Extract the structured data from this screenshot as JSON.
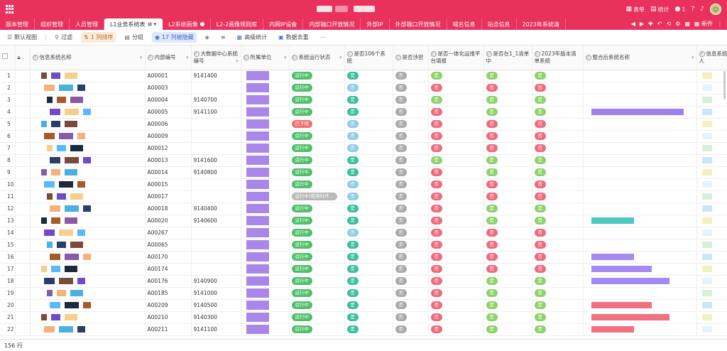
{
  "topbar": {
    "actions": [
      {
        "icon": "sheet-icon",
        "label": "表单"
      },
      {
        "icon": "stats-icon",
        "label": "统计"
      },
      {
        "icon": "user-icon",
        "label": "1"
      },
      {
        "icon": "help-icon",
        "label": ""
      },
      {
        "icon": "bell-icon",
        "label": ""
      }
    ],
    "brand_color": "#e8315c"
  },
  "tabs": [
    {
      "label": "版本管理"
    },
    {
      "label": "组织管理"
    },
    {
      "label": "人员管理"
    },
    {
      "label": "L1业务系统表",
      "active": true
    },
    {
      "label": "L2系统画像"
    },
    {
      "label": "L2-2画像规则库"
    },
    {
      "label": "内网IP设备"
    },
    {
      "label": "内部端口开放情况"
    },
    {
      "label": "外部IP"
    },
    {
      "label": "外部端口开放情况"
    },
    {
      "label": "域名信息"
    },
    {
      "label": "站点信息"
    },
    {
      "label": "2023年系统清"
    }
  ],
  "tab_tools": {
    "new_label": "新件"
  },
  "toolbar": {
    "default_view": "默认视图",
    "filter": "过滤",
    "sort": "1 列排序",
    "group": "分组",
    "hidden": "17 列被隐藏",
    "advanced_stats": "高级统计",
    "dedupe": "数据去重"
  },
  "columns": [
    {
      "label": "信息系统名称"
    },
    {
      "label": "内部编号"
    },
    {
      "label": "大数据中心系统编号"
    },
    {
      "label": "所属单位"
    },
    {
      "label": "系统运行状态"
    },
    {
      "label": "是否106个系统"
    },
    {
      "label": "是否涉密"
    },
    {
      "label": "是否一体化运维平台填报"
    },
    {
      "label": "是否在1_1清单中"
    },
    {
      "label": "2023年版本清单系统"
    },
    {
      "label": "整合后系统名称"
    },
    {
      "label": "信息系统联系人"
    }
  ],
  "rows": [
    {
      "n": "1",
      "id": "A00001",
      "bd": "9141400",
      "st": "运行中",
      "s106": "是",
      "sm": "否",
      "yt": "是",
      "q11": "是",
      "y23": "是"
    },
    {
      "n": "2",
      "id": "A00003",
      "bd": "",
      "st": "运行中",
      "s106": "否",
      "sm": "否",
      "yt": "否",
      "q11": "否",
      "y23": "否"
    },
    {
      "n": "3",
      "id": "A00004",
      "bd": "9140700",
      "st": "运行中",
      "s106": "是",
      "sm": "否",
      "yt": "是",
      "q11": "是",
      "y23": "是"
    },
    {
      "n": "4",
      "id": "A00005",
      "bd": "9141100",
      "st": "运行中",
      "s106": "是",
      "sm": "否",
      "yt": "否",
      "q11": "是",
      "y23": "是"
    },
    {
      "n": "5",
      "id": "A00006",
      "bd": "",
      "st": "已下线",
      "s106": "否",
      "sm": "否",
      "yt": "否",
      "q11": "否",
      "y23": "否"
    },
    {
      "n": "6",
      "id": "A00009",
      "bd": "",
      "st": "运行中",
      "s106": "否",
      "sm": "否",
      "yt": "否",
      "q11": "否",
      "y23": "否"
    },
    {
      "n": "7",
      "id": "A00012",
      "bd": "",
      "st": "运行中",
      "s106": "否",
      "sm": "否",
      "yt": "否",
      "q11": "否",
      "y23": "否"
    },
    {
      "n": "8",
      "id": "A00013",
      "bd": "9141600",
      "st": "运行中",
      "s106": "是",
      "sm": "否",
      "yt": "是",
      "q11": "是",
      "y23": "是"
    },
    {
      "n": "9",
      "id": "A00014",
      "bd": "9140800",
      "st": "运行中",
      "s106": "是",
      "sm": "否",
      "yt": "否",
      "q11": "是",
      "y23": "是"
    },
    {
      "n": "10",
      "id": "A00015",
      "bd": "",
      "st": "运行中",
      "s106": "否",
      "sm": "否",
      "yt": "否",
      "q11": "否",
      "y23": "否"
    },
    {
      "n": "11",
      "id": "A00017",
      "bd": "",
      "st": "运行中(使用时开...",
      "s106": "否",
      "sm": "否",
      "yt": "否",
      "q11": "否",
      "y23": "否"
    },
    {
      "n": "12",
      "id": "A00018",
      "bd": "9140400",
      "st": "运行中",
      "s106": "是",
      "sm": "否",
      "yt": "否",
      "q11": "是",
      "y23": "是"
    },
    {
      "n": "13",
      "id": "A00020",
      "bd": "9140600",
      "st": "运行中",
      "s106": "是",
      "sm": "否",
      "yt": "否",
      "q11": "是",
      "y23": "是"
    },
    {
      "n": "14",
      "id": "A00267",
      "bd": "",
      "st": "运行中",
      "s106": "否",
      "sm": "否",
      "yt": "否",
      "q11": "否",
      "y23": "否"
    },
    {
      "n": "15",
      "id": "A00065",
      "bd": "",
      "st": "运行中",
      "s106": "是",
      "sm": "否",
      "yt": "否",
      "q11": "否",
      "y23": "否"
    },
    {
      "n": "16",
      "id": "A00170",
      "bd": "",
      "st": "运行中",
      "s106": "是",
      "sm": "否",
      "yt": "否",
      "q11": "否",
      "y23": "否"
    },
    {
      "n": "17",
      "id": "A00174",
      "bd": "",
      "st": "运行中",
      "s106": "是",
      "sm": "否",
      "yt": "否",
      "q11": "否",
      "y23": "否"
    },
    {
      "n": "18",
      "id": "A00176",
      "bd": "9140900",
      "st": "运行中",
      "s106": "是",
      "sm": "否",
      "yt": "否",
      "q11": "是",
      "y23": "是"
    },
    {
      "n": "19",
      "id": "A00185",
      "bd": "9141000",
      "st": "运行中",
      "s106": "是",
      "sm": "否",
      "yt": "否",
      "q11": "是",
      "y23": "是"
    },
    {
      "n": "20",
      "id": "A00209",
      "bd": "9140500",
      "st": "运行中",
      "s106": "是",
      "sm": "否",
      "yt": "否",
      "q11": "是",
      "y23": "是"
    },
    {
      "n": "21",
      "id": "A00210",
      "bd": "9140300",
      "st": "运行中",
      "s106": "是",
      "sm": "否",
      "yt": "否",
      "q11": "是",
      "y23": "是"
    },
    {
      "n": "22",
      "id": "A00211",
      "bd": "9141100",
      "st": "运行中",
      "s106": "是",
      "sm": "否",
      "yt": "否",
      "q11": "是",
      "y23": "是"
    }
  ],
  "status": {
    "row_count": "156 行"
  }
}
